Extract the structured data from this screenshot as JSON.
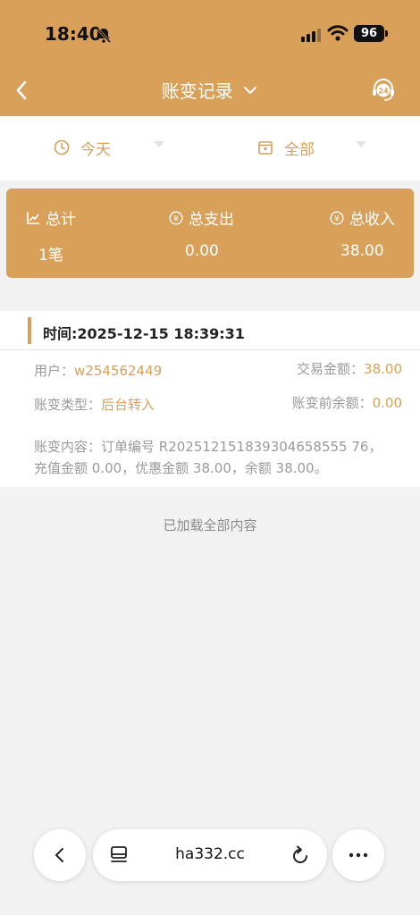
{
  "status_bar": {
    "time": "18:40",
    "battery": "96"
  },
  "nav": {
    "title": "账变记录"
  },
  "filters": {
    "date_label": "今天",
    "type_label": "全部"
  },
  "summary": {
    "total_label": "总计",
    "expense_label": "总支出",
    "income_label": "总收入",
    "total_value": "1笔",
    "expense_value": "0.00",
    "income_value": "38.00"
  },
  "record": {
    "time": "时间:2025-12-15 18:39:31",
    "user_label": "用户：",
    "user_value": "w254562449",
    "amount_label": "交易金额：",
    "amount_value": "38.00",
    "type_label": "账变类型：",
    "type_value": "后台转入",
    "before_label": "账变前余额：",
    "before_value": "0.00",
    "content": "账变内容：订单编号 R202512151839304658555 76，充值金额 0.00，优惠金额 38.00，余额 38.00。"
  },
  "list_footer": "已加载全部内容",
  "browser": {
    "url": "ha332.cc"
  },
  "colors": {
    "accent": "#d9a05a",
    "background": "#f2f2f2"
  }
}
